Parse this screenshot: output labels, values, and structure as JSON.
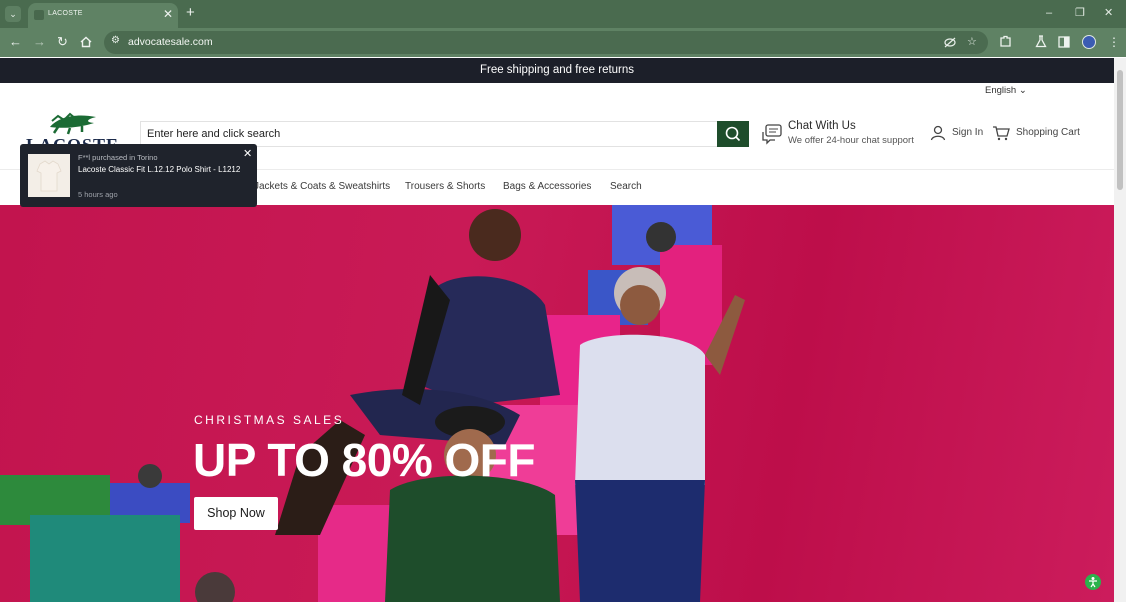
{
  "browser": {
    "tab_title": "LACOSTE",
    "tab_close": "✕",
    "new_tab": "+",
    "url": "advocatesale.com",
    "window_controls": [
      "–",
      "❐",
      "✕"
    ]
  },
  "announcement": "Free shipping and free returns",
  "header": {
    "language": "English",
    "logo_text": "LACOSTE",
    "search_placeholder": "Enter here and click search",
    "chat_title": "Chat With Us",
    "chat_subtitle": "We offer 24-hour chat support",
    "sign_in": "Sign In",
    "cart": "Shopping Cart"
  },
  "nav": {
    "items": [
      "Jackets & Coats & Sweatshirts",
      "Trousers & Shorts",
      "Bags & Accessories",
      "Search"
    ]
  },
  "hero": {
    "eyebrow": "CHRISTMAS SALES",
    "title": "UP TO 80% OFF",
    "button": "Shop Now"
  },
  "toast": {
    "line1": "F**l purchased in Torino",
    "product": "Lacoste Classic Fit L.12.12 Polo Shirt - L1212",
    "time": "5 hours ago",
    "close": "✕"
  },
  "colors": {
    "brand_green": "#1e4d2b",
    "hero_bg": "#c2144e",
    "announcement_bg": "#1c1f29",
    "chrome_green": "#5f8264"
  }
}
